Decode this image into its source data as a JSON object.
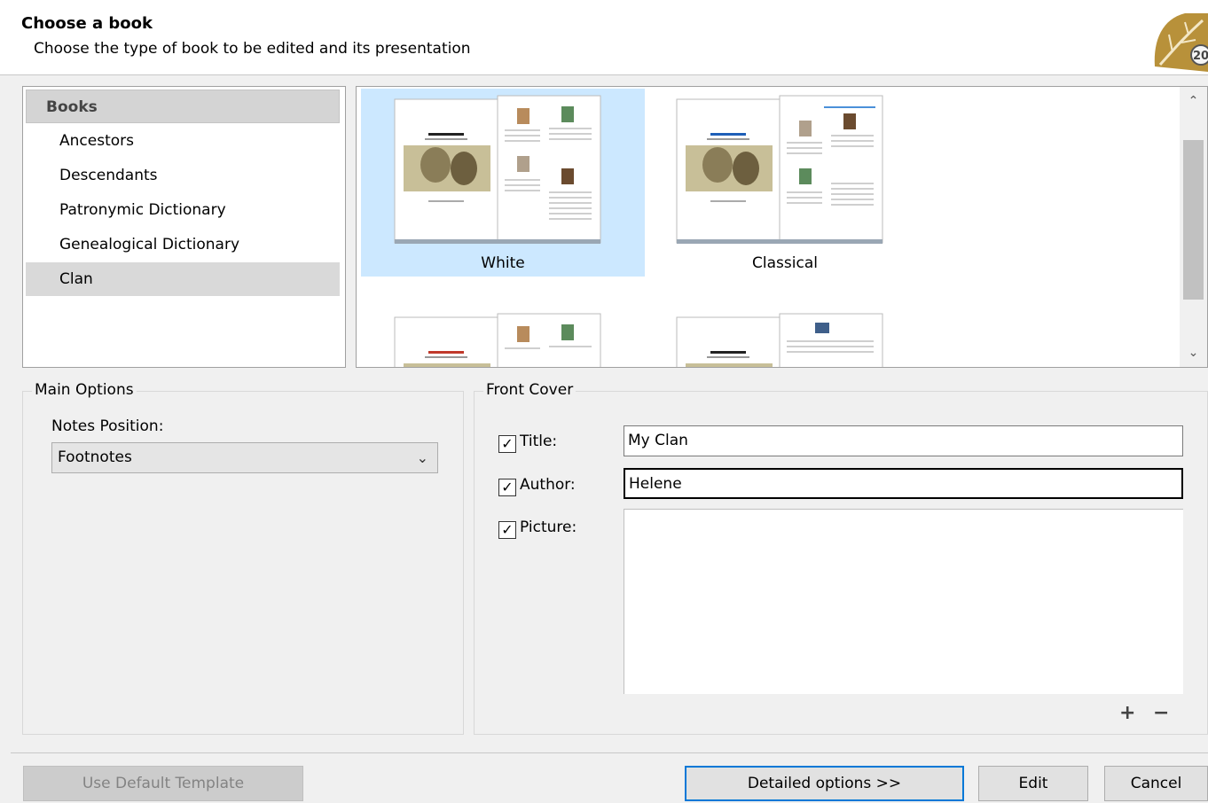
{
  "header": {
    "title": "Choose a book",
    "subtitle": "Choose the type of book to be edited and its presentation",
    "logo_icon": "leaf-2020-logo-icon"
  },
  "book_list": {
    "header": "Books",
    "items": [
      "Ancestors",
      "Descendants",
      "Patronymic Dictionary",
      "Genealogical Dictionary",
      "Clan"
    ],
    "selected": "Clan"
  },
  "templates": {
    "items": [
      {
        "label": "White",
        "selected": true
      },
      {
        "label": "Classical",
        "selected": false
      },
      {
        "label": "",
        "selected": false
      },
      {
        "label": "",
        "selected": false
      }
    ],
    "thumb_title_colors": [
      "#222222",
      "#1e5fb8",
      "#c0392b",
      "#222222"
    ]
  },
  "main_options": {
    "title": "Main Options",
    "notes_label": "Notes Position:",
    "notes_value": "Footnotes"
  },
  "front_cover": {
    "title": "Front Cover",
    "title_label": "Title:",
    "title_value": "My Clan",
    "author_label": "Author:",
    "author_value": "Helene",
    "picture_label": "Picture:",
    "check_mark": "✓",
    "add_icon": "+",
    "remove_icon": "−"
  },
  "buttons": {
    "use_default": "Use Default Template",
    "detailed": "Detailed options >>",
    "edit": "Edit",
    "cancel": "Cancel"
  },
  "colors": {
    "accent": "#0078d7",
    "selection": "#cce8ff",
    "logo_gold": "#b8913a"
  }
}
